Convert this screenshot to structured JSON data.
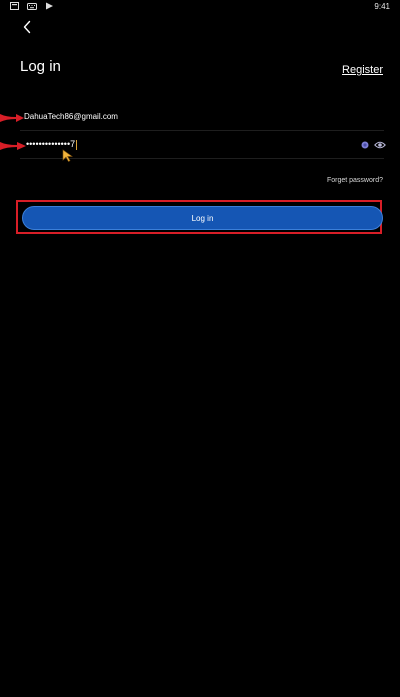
{
  "status_bar": {
    "time": "9:41",
    "icons": [
      "notification-icon",
      "keyboard-icon",
      "play-store-icon"
    ]
  },
  "header": {
    "back_icon": "chevron-left-icon",
    "title": "Log in",
    "register_label": "Register"
  },
  "form": {
    "email_value": "DahuaTech86@gmail.com",
    "password_mask": "••••••••••••••",
    "password_last_char": "7",
    "clear_icon": "clear-icon",
    "visibility_icon": "eye-icon",
    "forget_label": "Forget password?",
    "login_label": "Log in"
  },
  "annotations": {
    "marker_color": "#d81e27",
    "highlight_color": "#d81e27"
  },
  "colors": {
    "background": "#000000",
    "button": "#1556b4",
    "text": "#ffffff"
  }
}
